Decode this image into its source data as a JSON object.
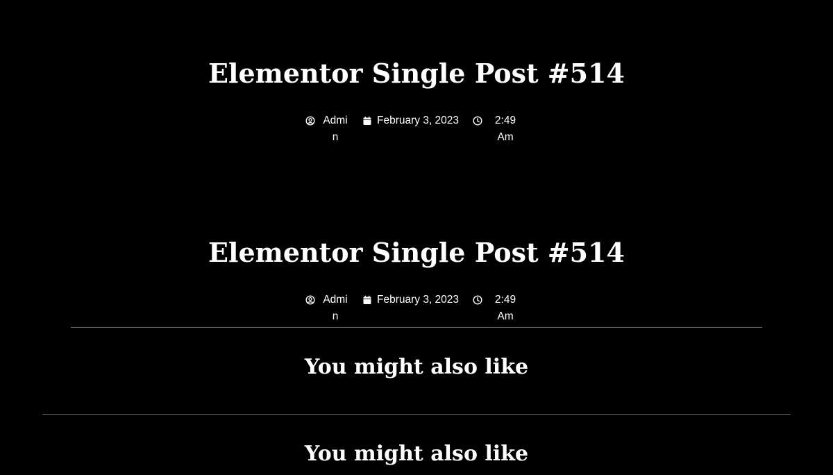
{
  "posts": [
    {
      "title": "Elementor Single Post #514",
      "author": "Admin",
      "date": "February 3, 2023",
      "time": "2:49 Am"
    },
    {
      "title": "Elementor Single Post #514",
      "author": "Admin",
      "date": "February 3, 2023",
      "time": "2:49 Am"
    }
  ],
  "related": {
    "heading_1": "You might also like",
    "heading_2": "You might also like"
  },
  "icons": {
    "author": "user-circle-icon",
    "date": "calendar-icon",
    "time": "clock-icon"
  },
  "colors": {
    "background": "#000000",
    "text": "#ffffff",
    "divider": "#666666"
  }
}
